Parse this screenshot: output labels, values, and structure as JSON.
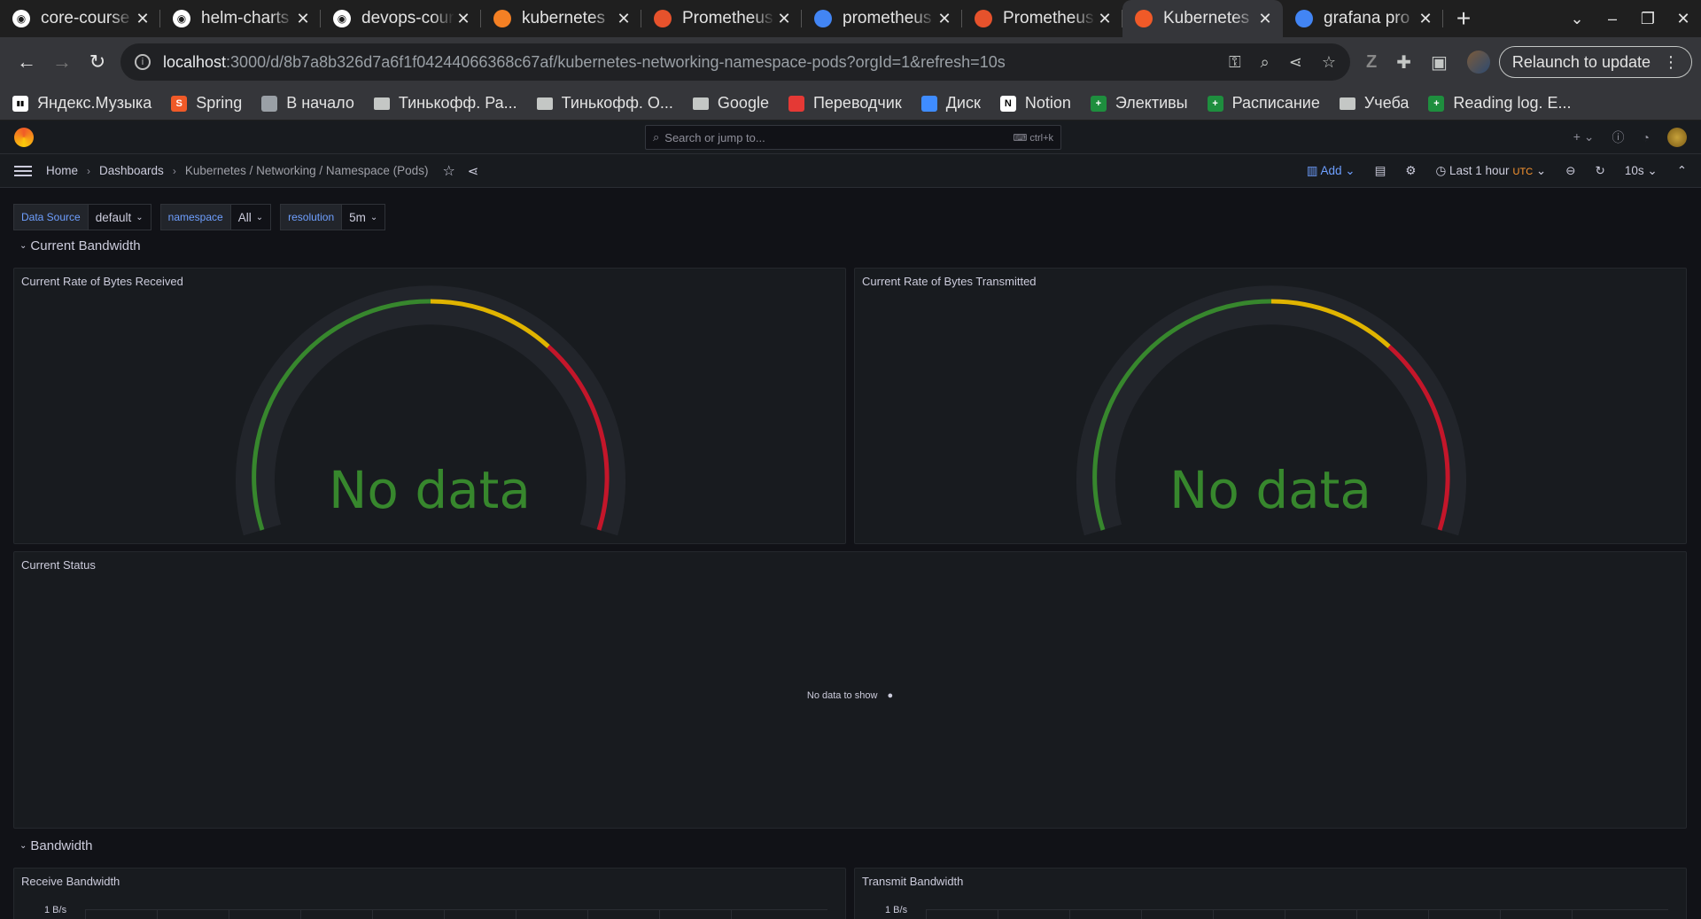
{
  "browser": {
    "tabs": [
      {
        "title": "core-course",
        "icon": "github-icon",
        "color": "#ffffff"
      },
      {
        "title": "helm-charts",
        "icon": "github-icon",
        "color": "#ffffff"
      },
      {
        "title": "devops-course",
        "icon": "github-icon",
        "color": "#ffffff"
      },
      {
        "title": "kubernetes",
        "icon": "stackoverflow-icon",
        "color": "#f48024"
      },
      {
        "title": "Prometheus",
        "icon": "prometheus-icon",
        "color": "#e6522c"
      },
      {
        "title": "prometheus",
        "icon": "google-icon",
        "color": "#4285f4"
      },
      {
        "title": "Prometheus",
        "icon": "prometheus-icon",
        "color": "#e6522c"
      },
      {
        "title": "Kubernetes",
        "icon": "grafana-icon",
        "color": "#f05a28",
        "active": true
      },
      {
        "title": "grafana pro",
        "icon": "google-icon",
        "color": "#4285f4"
      }
    ],
    "url_host": "localhost",
    "url_path": ":3000/d/8b7a8b326d7a6f1f04244066368c67af/kubernetes-networking-namespace-pods?orgId=1&refresh=10s",
    "relaunch_label": "Relaunch to update",
    "bookmarks": [
      {
        "label": "Яндекс.Музыка",
        "icon": "yandex-music-icon",
        "color": "#ffffff"
      },
      {
        "label": "Spring",
        "icon": "spring-icon",
        "color": "#f05a28"
      },
      {
        "label": "В начало",
        "icon": "page-icon",
        "color": "#9aa0a6"
      },
      {
        "label": "Тинькофф. Ра...",
        "icon": "folder-icon",
        "color": "#c4c7c5"
      },
      {
        "label": "Тинькофф. О...",
        "icon": "folder-icon",
        "color": "#c4c7c5"
      },
      {
        "label": "Google",
        "icon": "folder-icon",
        "color": "#c4c7c5"
      },
      {
        "label": "Переводчик",
        "icon": "translate-icon",
        "color": "#e53935"
      },
      {
        "label": "Диск",
        "icon": "disk-icon",
        "color": "#3f8cff"
      },
      {
        "label": "Notion",
        "icon": "notion-icon",
        "color": "#ffffff"
      },
      {
        "label": "Элективы",
        "icon": "sheets-icon",
        "color": "#1e8e3e"
      },
      {
        "label": "Расписание",
        "icon": "sheets-icon",
        "color": "#1e8e3e"
      },
      {
        "label": "Учеба",
        "icon": "folder-icon",
        "color": "#c4c7c5"
      },
      {
        "label": "Reading log. E...",
        "icon": "sheets-icon",
        "color": "#1e8e3e"
      }
    ]
  },
  "grafana": {
    "search_placeholder": "Search or jump to...",
    "search_shortcut": "ctrl+k",
    "breadcrumbs": [
      "Home",
      "Dashboards",
      "Kubernetes / Networking / Namespace (Pods)"
    ],
    "add_label": "Add",
    "time_range": "Last 1 hour",
    "timezone": "UTC",
    "refresh": "10s",
    "variables": [
      {
        "label": "Data Source",
        "value": "default"
      },
      {
        "label": "namespace",
        "value": "All"
      },
      {
        "label": "resolution",
        "value": "5m"
      }
    ],
    "rows": {
      "current_bandwidth": "Current Bandwidth",
      "bandwidth": "Bandwidth"
    },
    "panels": {
      "received_title": "Current Rate of Bytes Received",
      "transmitted_title": "Current Rate of Bytes Transmitted",
      "gauge_no_data": "No data",
      "status_title": "Current Status",
      "status_no_data": "No data to show",
      "receive_bw_title": "Receive Bandwidth",
      "transmit_bw_title": "Transmit Bandwidth",
      "axis_top": "1 B/s"
    },
    "colors": {
      "green": "#37872d",
      "yellow": "#e0b400",
      "red": "#c4162a",
      "accent": "#6e9fff"
    }
  }
}
